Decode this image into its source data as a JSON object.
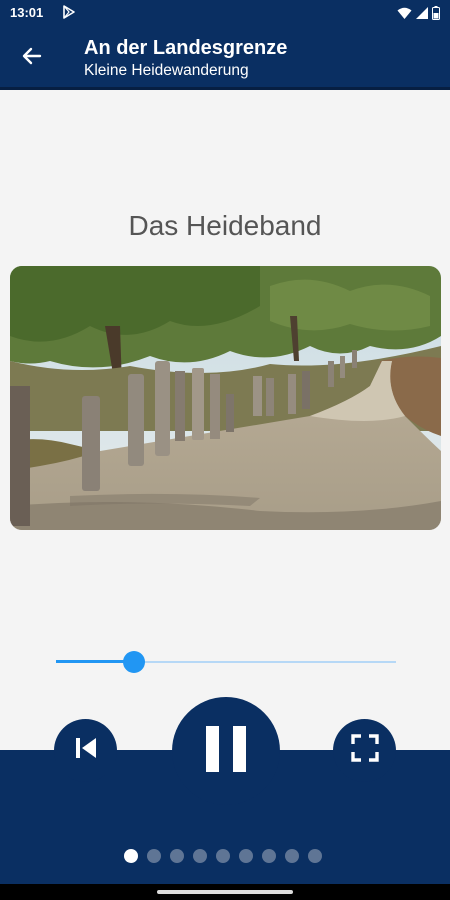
{
  "status_bar": {
    "time": "13:01",
    "icons": [
      "play-store-icon",
      "wifi-icon",
      "signal-icon",
      "battery-icon"
    ]
  },
  "app_bar": {
    "title": "An der Landesgrenze",
    "subtitle": "Kleine Heidewanderung",
    "back_icon": "arrow-left-icon"
  },
  "content": {
    "title": "Das Heideband",
    "image": "heath-trail-photo"
  },
  "player": {
    "progress": 0.23,
    "controls": {
      "previous_icon": "skip-previous-icon",
      "pause_icon": "pause-icon",
      "fullscreen_icon": "fullscreen-icon"
    }
  },
  "pager": {
    "count": 9,
    "active_index": 0
  },
  "colors": {
    "primary": "#0a2f62",
    "accent": "#2196f3",
    "track": "#b6d8f6",
    "background": "#f4f4f4",
    "title_text": "#555555"
  }
}
